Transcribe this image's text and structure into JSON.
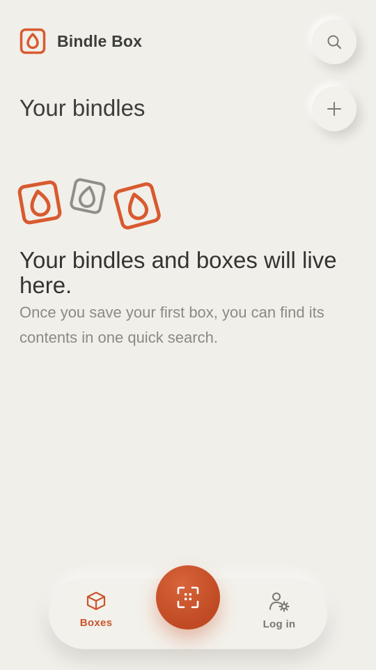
{
  "app": {
    "title": "Bindle Box",
    "logo_icon": "bindle-logo-icon",
    "accent_color": "#c9552d"
  },
  "header": {
    "search_icon": "search-icon",
    "add_icon": "plus-icon"
  },
  "main": {
    "section_title": "Your bindles",
    "empty_state": {
      "illustration_icons": [
        "bindle-logo-icon",
        "bindle-logo-icon",
        "bindle-logo-icon"
      ],
      "title": "Your bindles and boxes will live here.",
      "text": "Once you save your first box, you can find its contents in one quick search."
    }
  },
  "nav": {
    "items": [
      {
        "label": "Boxes",
        "icon": "box-icon",
        "active": true
      },
      {
        "label": "Log in",
        "icon": "user-settings-icon",
        "active": false
      }
    ],
    "scan_icon": "scan-icon"
  }
}
